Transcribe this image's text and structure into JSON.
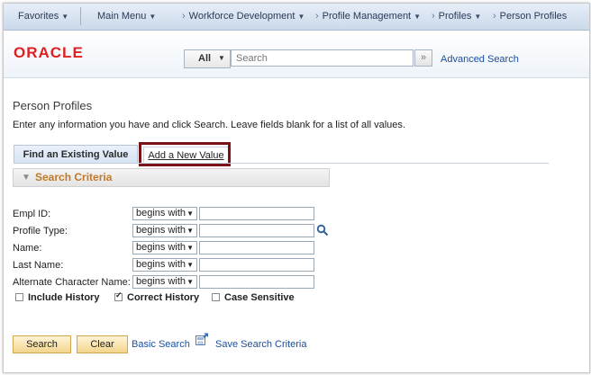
{
  "nav": {
    "favorites": "Favorites",
    "main_menu": "Main Menu",
    "crumbs": [
      "Workforce Development",
      "Profile Management",
      "Profiles",
      "Person Profiles"
    ]
  },
  "header": {
    "logo": "ORACLE",
    "scope": "All",
    "search_placeholder": "Search",
    "advanced_search": "Advanced Search"
  },
  "page": {
    "title": "Person Profiles",
    "instructions": "Enter any information you have and click Search. Leave fields blank for a list of all values."
  },
  "tabs": {
    "find": "Find an Existing Value",
    "add": "Add a New Value"
  },
  "criteria": {
    "title": "Search Criteria",
    "fields": [
      {
        "label": "Empl ID:",
        "operator": "begins with",
        "value": ""
      },
      {
        "label": "Profile Type:",
        "operator": "begins with",
        "value": ""
      },
      {
        "label": "Name:",
        "operator": "begins with",
        "value": ""
      },
      {
        "label": "Last Name:",
        "operator": "begins with",
        "value": ""
      },
      {
        "label": "Alternate Character Name:",
        "operator": "begins with",
        "value": ""
      }
    ],
    "checkboxes": [
      {
        "label": "Include History",
        "checked": false
      },
      {
        "label": "Correct History",
        "checked": true
      },
      {
        "label": "Case Sensitive",
        "checked": false
      }
    ]
  },
  "actions": {
    "search": "Search",
    "clear": "Clear",
    "basic_search": "Basic Search",
    "save_criteria": "Save Search Criteria"
  },
  "colors": {
    "logo": "#e02020",
    "link": "#1a4fa0",
    "criteria_title": "#c07a2b",
    "highlight": "#7a1318",
    "button": "#f4d48d"
  }
}
